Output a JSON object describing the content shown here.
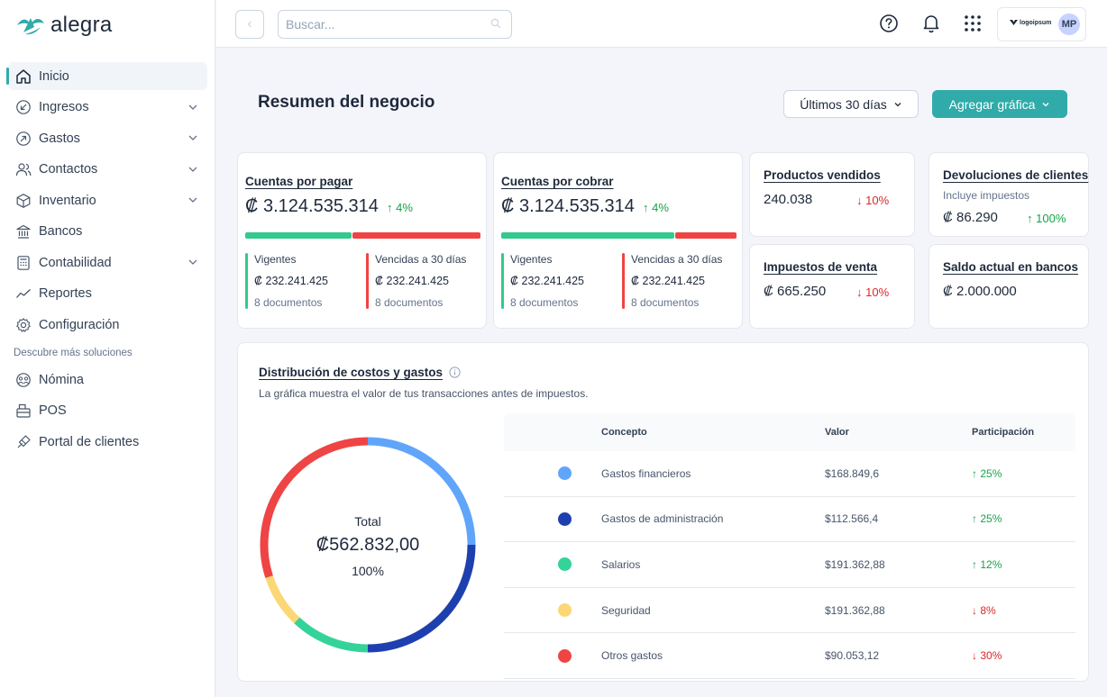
{
  "app": {
    "logo_text": "alegra"
  },
  "sidebar": {
    "items": [
      {
        "label": "Inicio",
        "icon": "home-icon",
        "active": true,
        "chevron": false
      },
      {
        "label": "Ingresos",
        "icon": "income-icon",
        "active": false,
        "chevron": true
      },
      {
        "label": "Gastos",
        "icon": "expenses-icon",
        "active": false,
        "chevron": true
      },
      {
        "label": "Contactos",
        "icon": "contacts-icon",
        "active": false,
        "chevron": true
      },
      {
        "label": "Inventario",
        "icon": "inventory-icon",
        "active": false,
        "chevron": true
      },
      {
        "label": "Bancos",
        "icon": "bank-icon",
        "active": false,
        "chevron": false
      },
      {
        "label": "Contabilidad",
        "icon": "accounting-icon",
        "active": false,
        "chevron": true
      },
      {
        "label": "Reportes",
        "icon": "reports-icon",
        "active": false,
        "chevron": false
      },
      {
        "label": "Configuración",
        "icon": "settings-icon",
        "active": false,
        "chevron": false
      }
    ],
    "section_label": "Descubre más soluciones",
    "solutions": [
      {
        "label": "Nómina",
        "icon": "payroll-icon"
      },
      {
        "label": "POS",
        "icon": "pos-icon"
      },
      {
        "label": "Portal de clientes",
        "icon": "portal-icon"
      }
    ]
  },
  "topbar": {
    "search_placeholder": "Buscar...",
    "company_logo_text": "logoipsum",
    "avatar_initials": "MP"
  },
  "header": {
    "title": "Resumen del negocio",
    "period_label": "Últimos 30 días",
    "add_chart_label": "Agregar gráfica"
  },
  "payables": {
    "title": "Cuentas por pagar",
    "amount": "₡ 3.124.535.314",
    "trend": "4%",
    "current_label": "Vigentes",
    "current_amount": "₡ 232.241.425",
    "current_docs": "8 documentos",
    "overdue_label": "Vencidas a 30 días",
    "overdue_amount": "₡ 232.241.425",
    "overdue_docs": "8 documentos"
  },
  "receivables": {
    "title": "Cuentas por cobrar",
    "amount": "₡ 3.124.535.314",
    "trend": "4%",
    "current_label": "Vigentes",
    "current_amount": "₡ 232.241.425",
    "current_docs": "8 documentos",
    "overdue_label": "Vencidas a 30 días",
    "overdue_amount": "₡ 232.241.425",
    "overdue_docs": "8 documentos"
  },
  "products_sold": {
    "title": "Productos vendidos",
    "value": "240.038",
    "trend": "10%"
  },
  "returns": {
    "title": "Devoluciones de clientes",
    "note": "Incluye impuestos",
    "value": "₡ 86.290",
    "trend": "100%"
  },
  "sales_tax": {
    "title": "Impuestos de venta",
    "value": "₡ 665.250",
    "trend": "10%"
  },
  "bank_balance": {
    "title": "Saldo actual en bancos",
    "value": "₡ 2.000.000"
  },
  "distribution": {
    "title": "Distribución de costos y gastos",
    "subtitle": "La gráfica muestra el valor de tus transacciones antes de impuestos.",
    "total_label": "Total",
    "total_value": "₡562.832,00",
    "total_percent": "100%",
    "headers": {
      "concept": "Concepto",
      "value": "Valor",
      "share": "Participación"
    },
    "rows": [
      {
        "concept": "Gastos financieros",
        "value": "$168.849,6",
        "share": "25%",
        "direction": "up",
        "color": "#60a5fa"
      },
      {
        "concept": "Gastos de administración",
        "value": "$112.566,4",
        "share": "25%",
        "direction": "up",
        "color": "#1e40af"
      },
      {
        "concept": "Salarios",
        "value": "$191.362,88",
        "share": "12%",
        "direction": "up",
        "color": "#34d399"
      },
      {
        "concept": "Seguridad",
        "value": "$191.362,88",
        "share": "8%",
        "direction": "down",
        "color": "#fcd775"
      },
      {
        "concept": "Otros gastos",
        "value": "$90.053,12",
        "share": "30%",
        "direction": "down",
        "color": "#ef4444"
      }
    ]
  },
  "colors": {
    "accent": "#30aba9",
    "positive": "#16a34a",
    "negative": "#dc2626",
    "current_bar": "#34c98e",
    "overdue_bar": "#ef4444"
  },
  "chart_data": {
    "type": "pie",
    "categories": [
      "Gastos financieros",
      "Gastos de administración",
      "Salarios",
      "Seguridad",
      "Otros gastos"
    ],
    "values": [
      25,
      25,
      12,
      8,
      30
    ],
    "colors": [
      "#60a5fa",
      "#1e40af",
      "#34d399",
      "#fcd775",
      "#ef4444"
    ],
    "title": "Distribución de costos y gastos"
  }
}
